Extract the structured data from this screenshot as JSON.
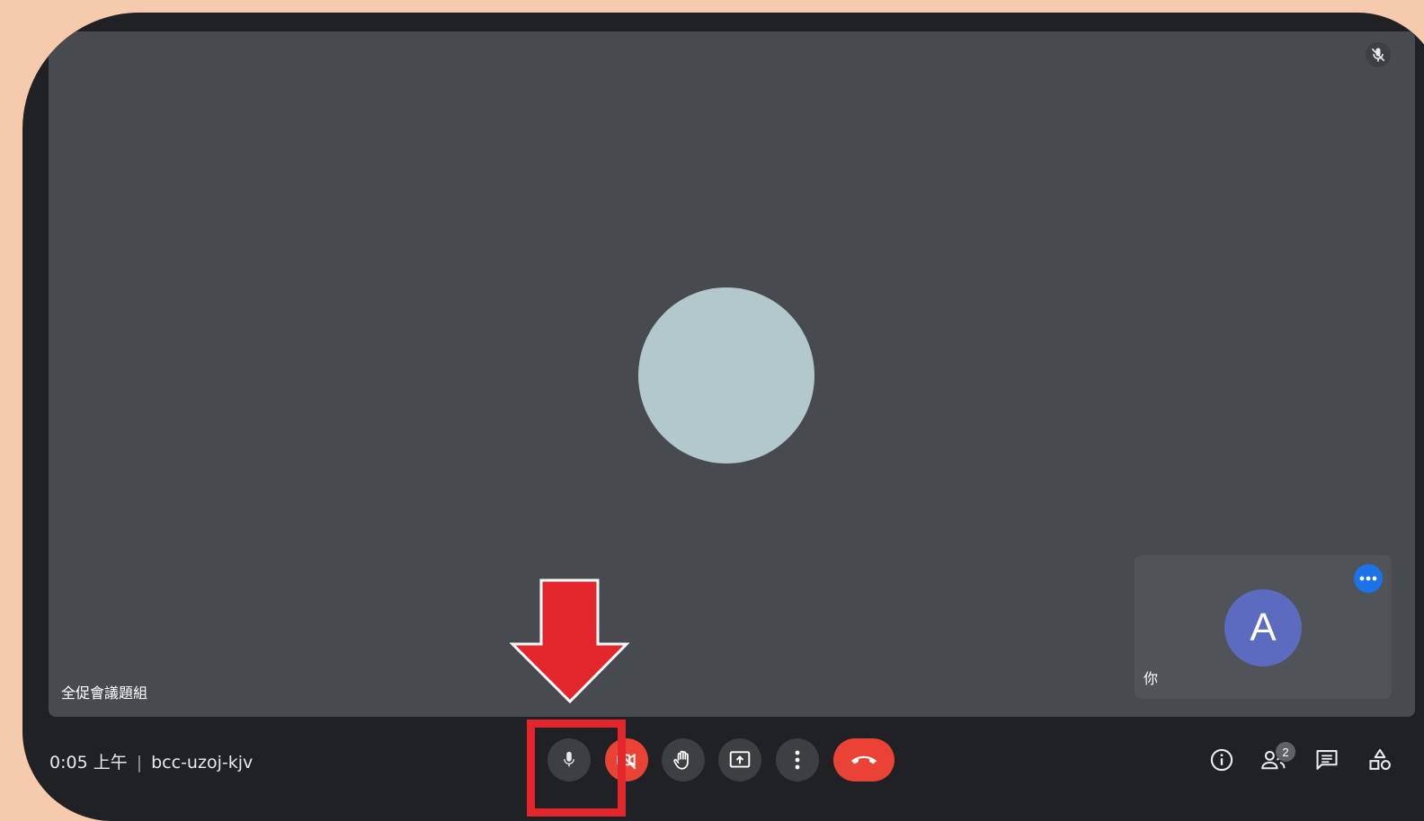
{
  "stage": {
    "speaker_name": "全促會議題組"
  },
  "self_tile": {
    "avatar_letter": "A",
    "label": "你"
  },
  "bottom_bar": {
    "time": "0:05 上午",
    "separator": "|",
    "meeting_code": "bcc-uzoj-kjv",
    "controls": [
      "mic-icon",
      "camera-off-icon",
      "raise-hand-icon",
      "present-screen-icon",
      "more-options-icon",
      "hang-up-icon"
    ],
    "right_icons": [
      "info-icon",
      "people-icon",
      "chat-icon",
      "activities-icon"
    ],
    "participants_count": "2"
  },
  "annotation": {
    "arrow_color": "#e3262b",
    "box_color": "#e3262b"
  },
  "colors": {
    "background": "#f6cbad",
    "frame": "#202124",
    "stage": "#474a4e",
    "main_avatar": "#b2c8ca",
    "self_avatar": "#5c6bc0",
    "danger": "#ea4335",
    "accent": "#1a73e8"
  }
}
